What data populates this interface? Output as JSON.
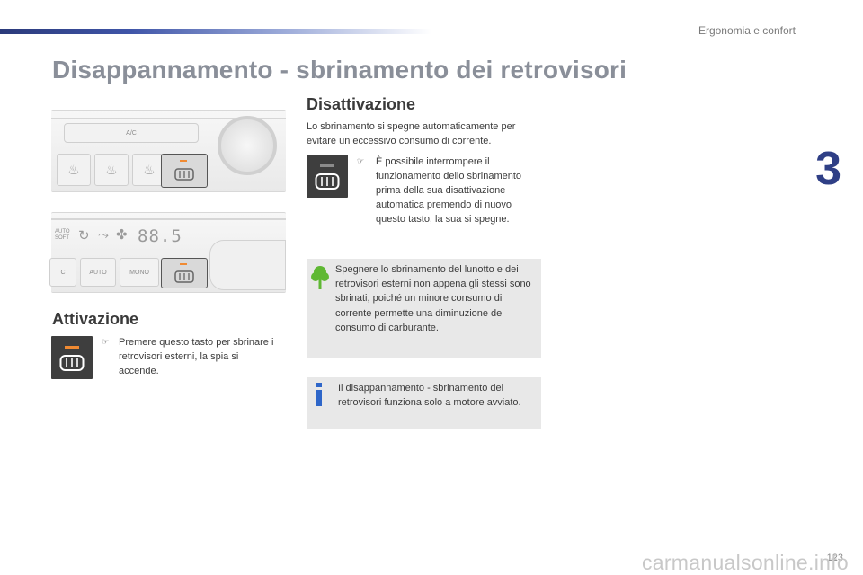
{
  "header": {
    "section_label": "Ergonomia e confort",
    "chapter_number": "3"
  },
  "page_title": "Disappannamento - sbrinamento dei retrovisori",
  "panel_top": {
    "ac_label": "A/C"
  },
  "panel_bottom": {
    "mode_label": "AUTO\nSOFT",
    "display_value": "88.5",
    "auto_label": "AUTO",
    "mono_label": "MONO",
    "left_partial_label": "C"
  },
  "attivazione": {
    "heading": "Attivazione",
    "bullet": "",
    "text": "Premere questo tasto per sbrinare i retrovisori esterni, la spia si accende."
  },
  "disattivazione": {
    "heading": "Disattivazione",
    "intro": "Lo sbrinamento si spegne automaticamente per evitare un eccessivo consumo di corrente.",
    "bullet": "",
    "text": "È possibile interrompere il funzionamento dello sbrinamento prima della sua disattivazione automatica premendo di nuovo questo tasto, la sua si spegne."
  },
  "eco_note": {
    "icon": "tree-icon",
    "icon_color": "#5fb833",
    "text": "Spegnere lo sbrinamento del lunotto e dei retrovisori esterni non appena gli stessi sono sbrinati, poiché un minore consumo di corrente permette una diminuzione del consumo di carburante."
  },
  "info_note": {
    "icon": "info-icon",
    "icon_color": "#2e66c9",
    "text": "Il disappannamento - sbrinamento dei retrovisori funziona solo a motore avviato."
  },
  "footer": {
    "page_number": "123",
    "watermark": "carmanualsonline.info"
  },
  "colors": {
    "brand_blue": "#2f3f86",
    "led_orange": "#f08a32",
    "note_bg": "#e8e8e8"
  }
}
